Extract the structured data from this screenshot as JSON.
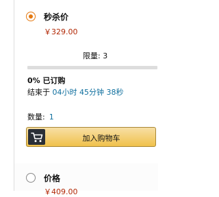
{
  "deal_option": {
    "title": "秒杀价",
    "price": "￥329.00",
    "limit_label": "限量:",
    "limit_value": "3",
    "progress_percent": 0,
    "claimed_text": "0% 已订购",
    "ends_prefix": "结束于",
    "ends_time": "04小时 45分钟 38秒",
    "quantity_label": "数量:",
    "quantity_value": "1",
    "add_to_cart_label": "加入购物车",
    "selected": true
  },
  "regular_option": {
    "title": "价格",
    "price": "￥409.00",
    "selected": false
  },
  "icons": [
    "radio-selected-icon",
    "cart-icon",
    "radio-unselected-icon"
  ],
  "colors": {
    "accent": "#e47911",
    "price": "#b12704",
    "button_bg": "#f0c14b",
    "link": "#0f6f9e"
  }
}
